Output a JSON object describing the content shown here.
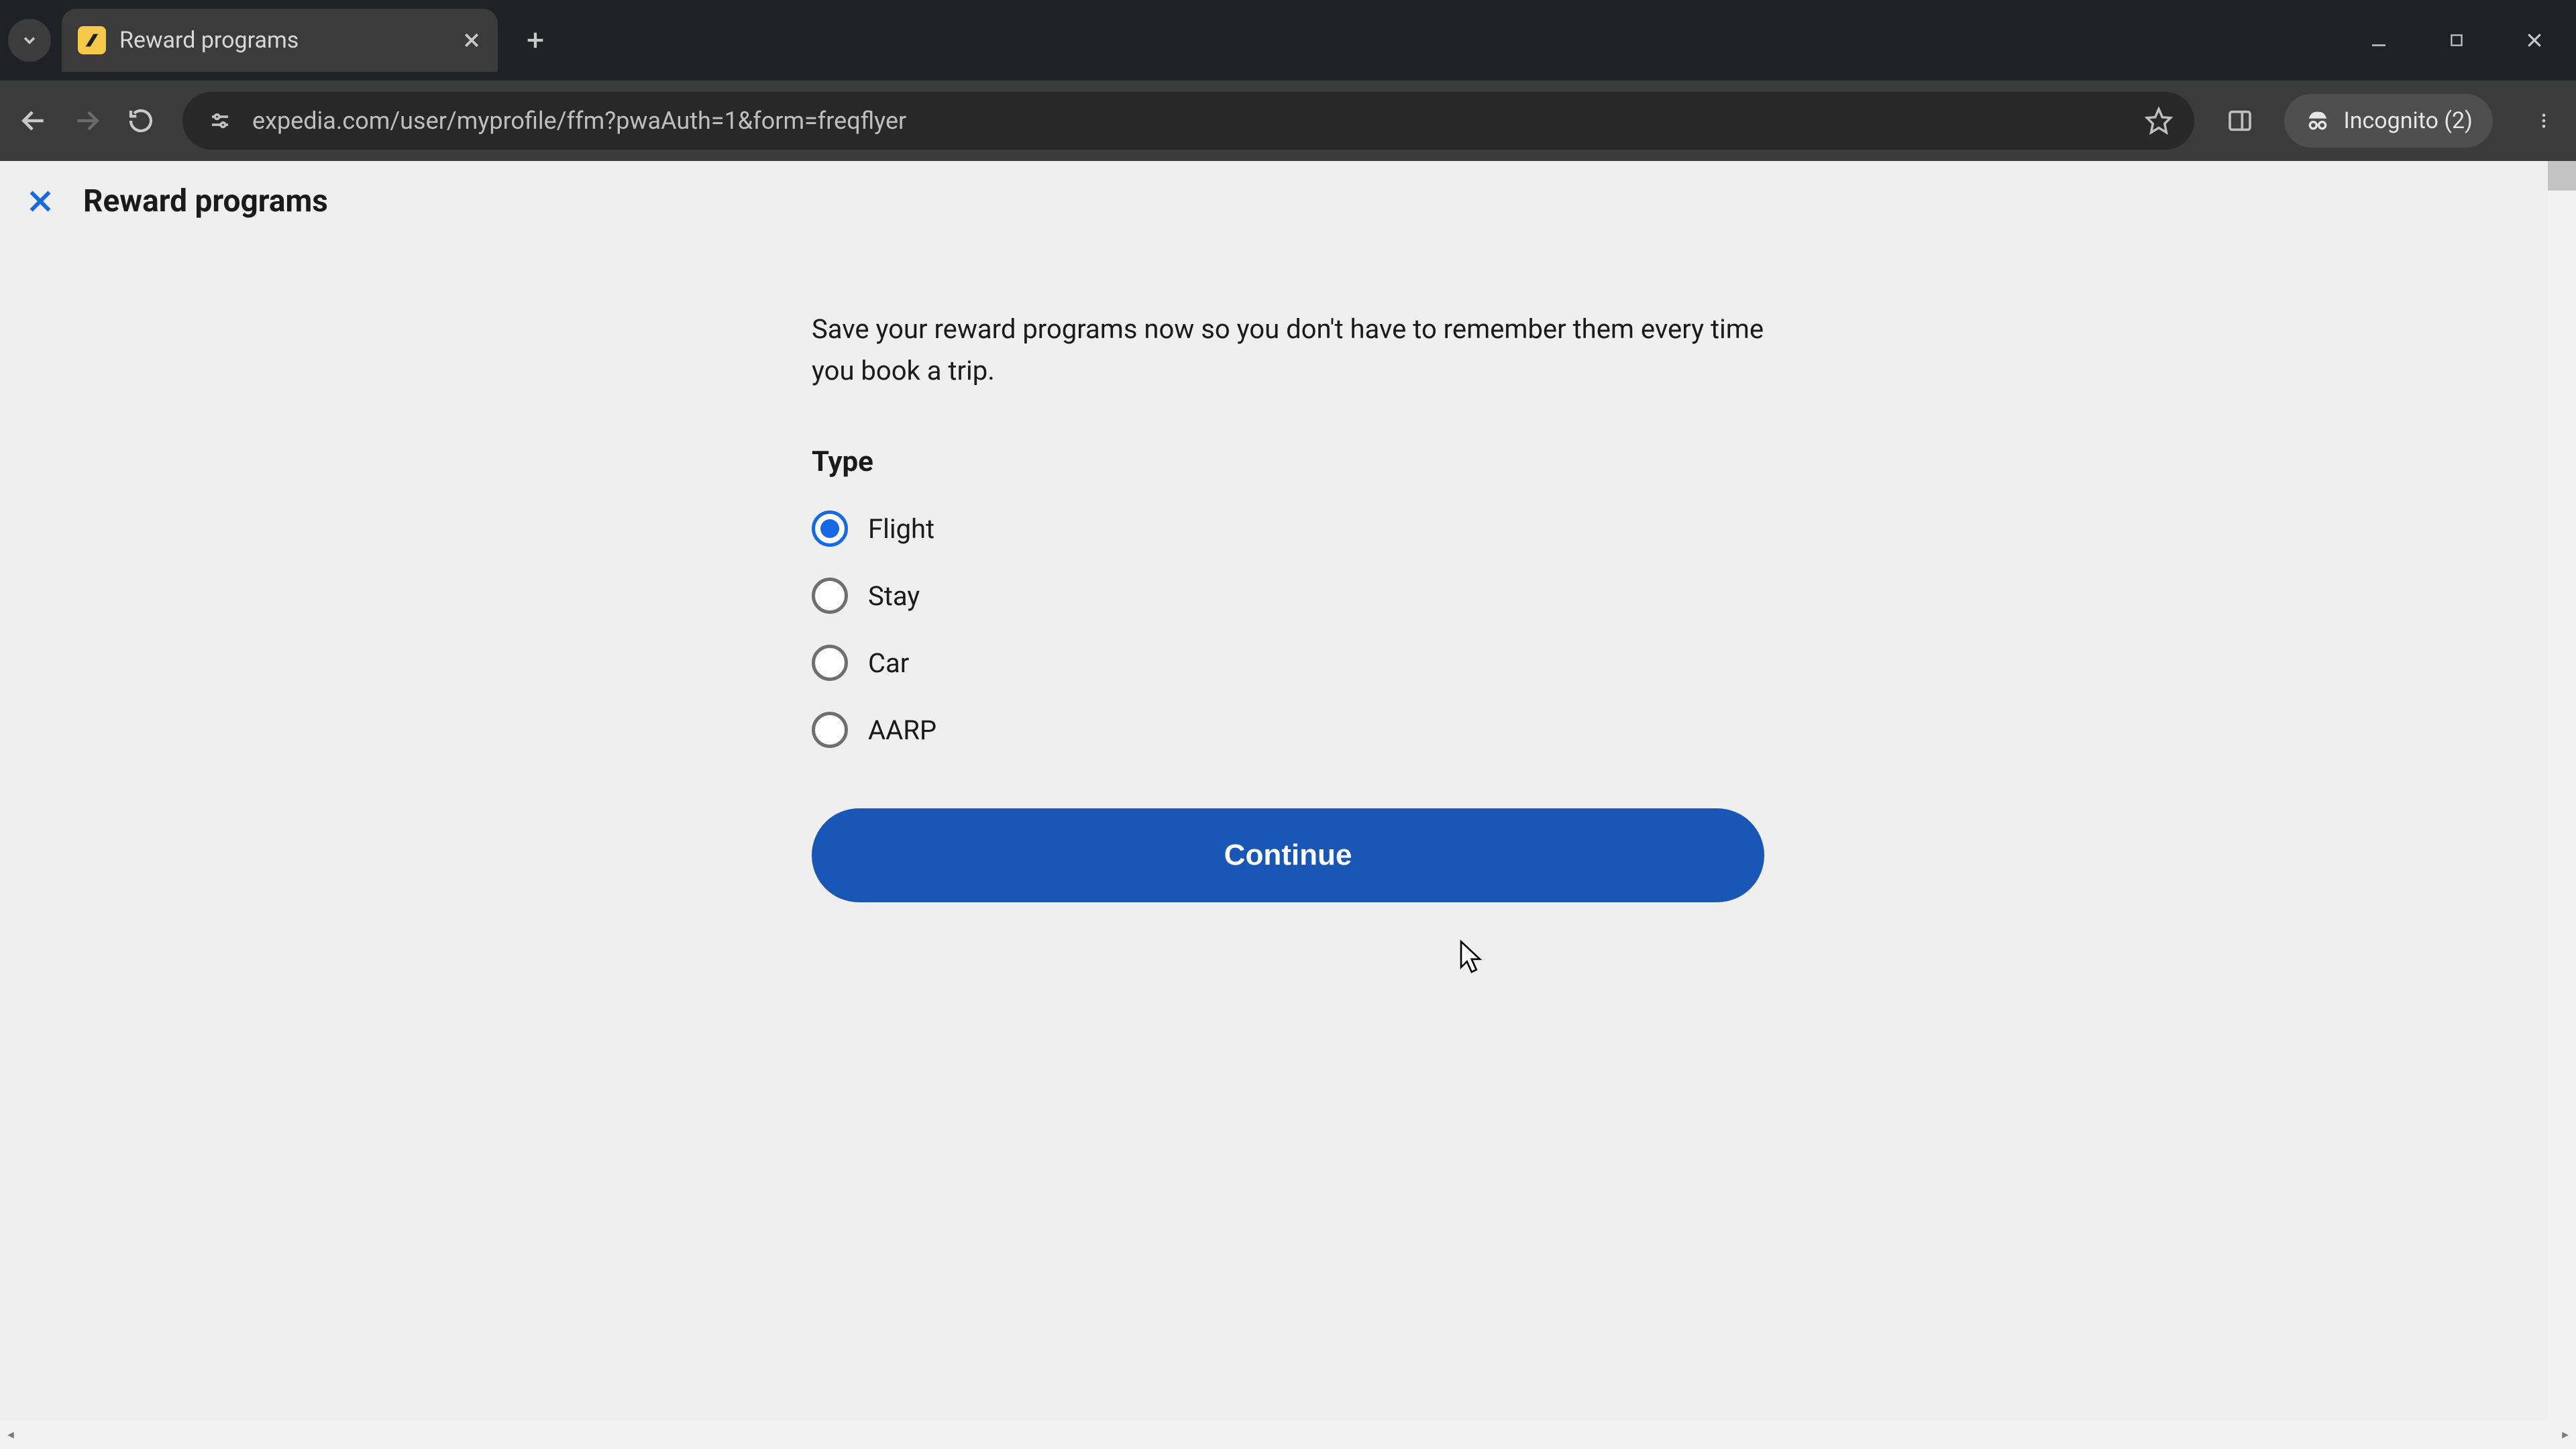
{
  "browser": {
    "tab_title": "Reward programs",
    "url": "expedia.com/user/myprofile/ffm?pwaAuth=1&form=freqflyer",
    "incognito_label": "Incognito (2)"
  },
  "page": {
    "header_title": "Reward programs",
    "intro": "Save your reward programs now so you don't have to remember them every time you book a trip.",
    "type_section_label": "Type",
    "radio_options": [
      {
        "label": "Flight",
        "selected": true
      },
      {
        "label": "Stay",
        "selected": false
      },
      {
        "label": "Car",
        "selected": false
      },
      {
        "label": "AARP",
        "selected": false
      }
    ],
    "continue_label": "Continue"
  }
}
